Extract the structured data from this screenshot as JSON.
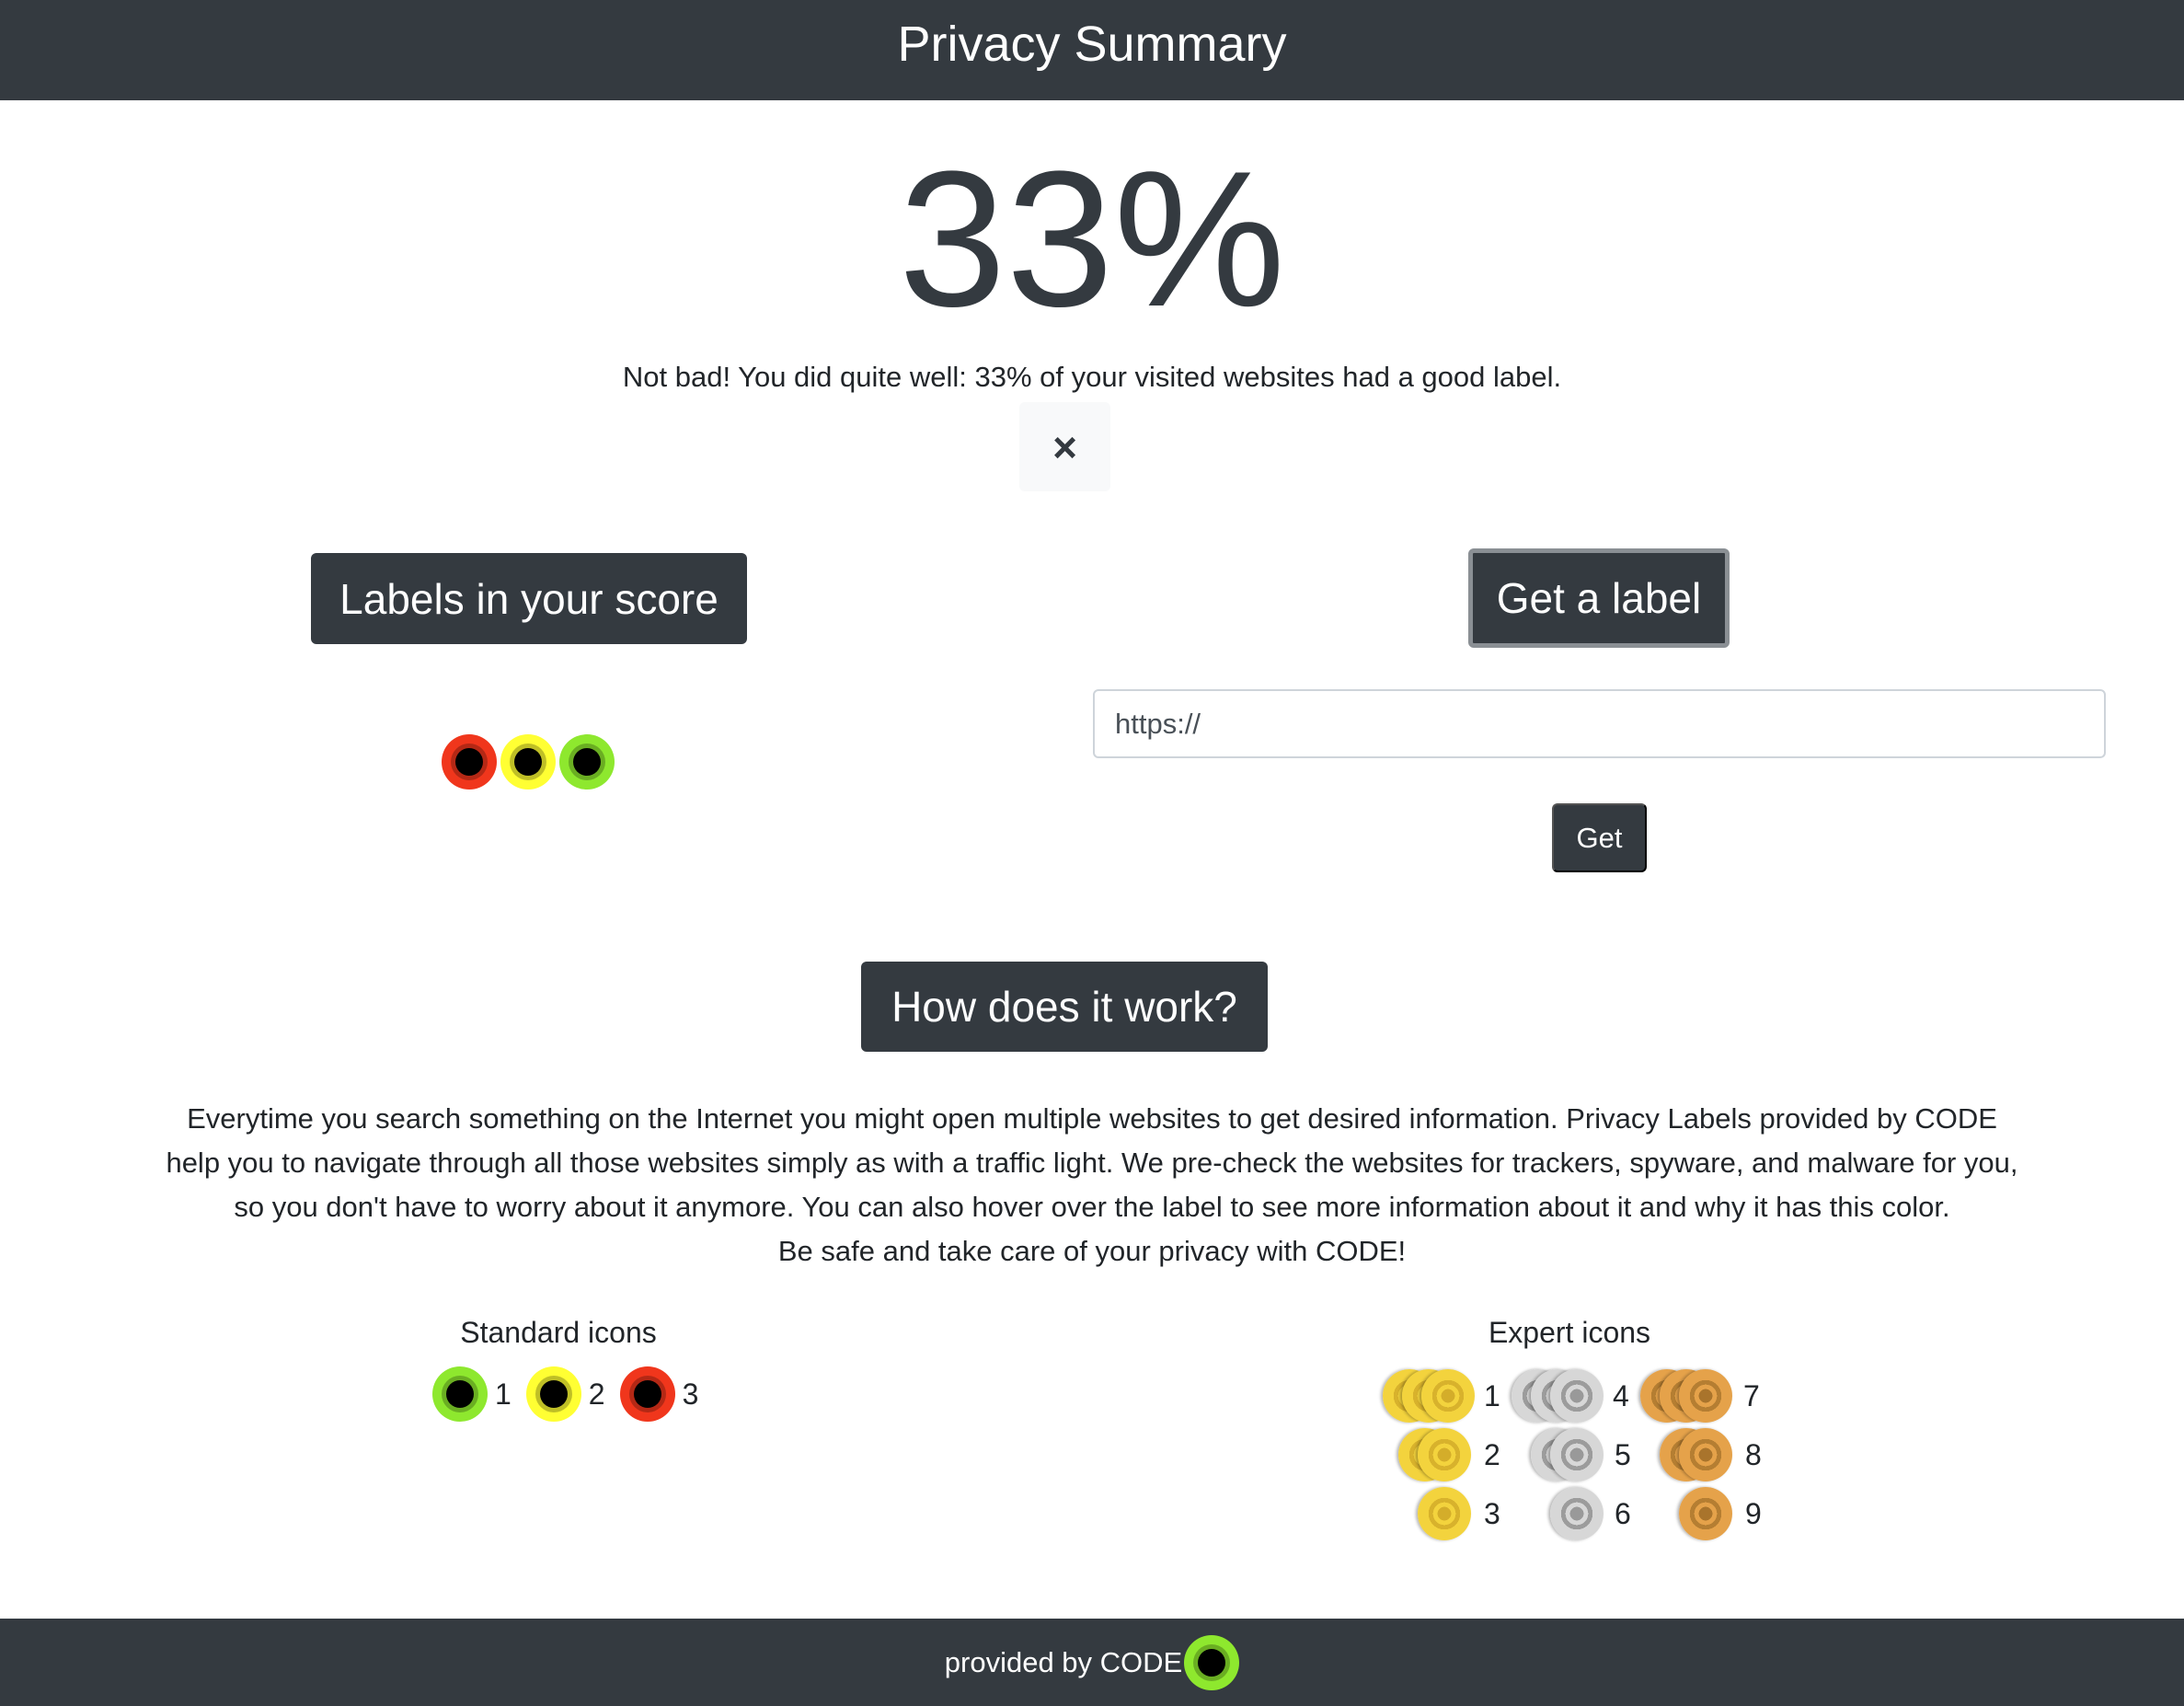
{
  "header": {
    "title": "Privacy Summary"
  },
  "score": {
    "value": "33%",
    "message": "Not bad! You did quite well: 33% of your visited websites had a good label.",
    "close_icon": "×"
  },
  "labels_section": {
    "title": "Labels in your score",
    "labels": [
      "red",
      "yellow",
      "green"
    ]
  },
  "get_label": {
    "title": "Get a label",
    "input_value": "https://",
    "button": "Get"
  },
  "how": {
    "title": "How does it work?",
    "lines": [
      "Everytime you search something on the Internet you might open multiple websites to get desired information. Privacy Labels provided by CODE",
      "help you to navigate through all those websites simply as with a traffic light. We pre-check the websites for trackers, spyware, and malware for you,",
      "so you don't have to worry about it anymore. You can also hover over the label to see more information about it and why it has this color.",
      "Be safe and take care of your privacy with CODE!"
    ]
  },
  "standard": {
    "title": "Standard icons",
    "items": [
      {
        "color": "green",
        "num": "1"
      },
      {
        "color": "yellow",
        "num": "2"
      },
      {
        "color": "red",
        "num": "3"
      }
    ]
  },
  "expert": {
    "title": "Expert icons",
    "nums": [
      "1",
      "2",
      "3",
      "4",
      "5",
      "6",
      "7",
      "8",
      "9"
    ]
  },
  "footer": {
    "text": "provided by CODE"
  },
  "colors": {
    "dark": "#343a40",
    "red": "#f0361c",
    "yellow": "#ffff33",
    "green": "#8ee82e"
  }
}
